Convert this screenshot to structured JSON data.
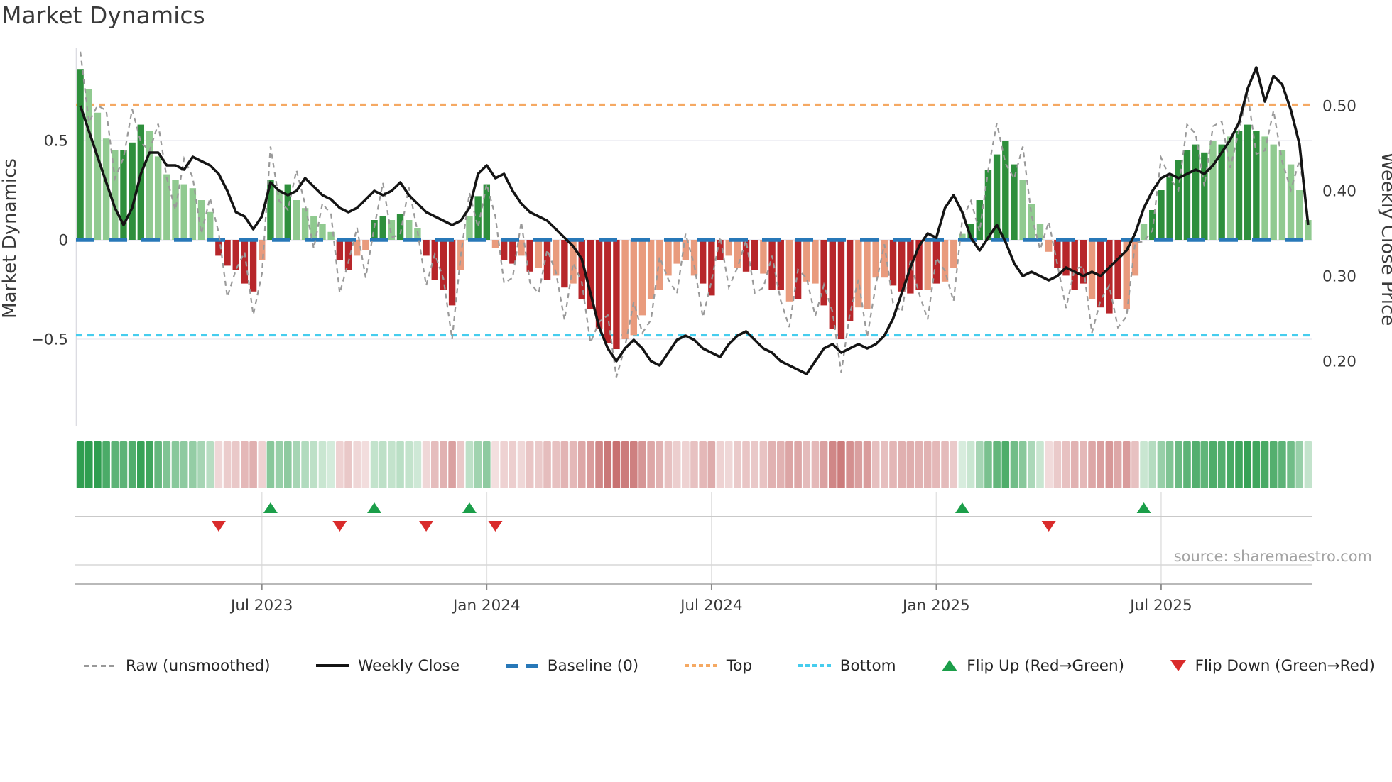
{
  "title": "Market Dynamics",
  "source_note": "source: sharemaestro.com",
  "axes": {
    "left": {
      "title": "Market Dynamics",
      "ticks": [
        {
          "label": "0.5",
          "value": 0.5
        },
        {
          "label": "0",
          "value": 0
        },
        {
          "label": "−0.5",
          "value": -0.5
        }
      ]
    },
    "right": {
      "title": "Weekly Close Price",
      "ticks": [
        {
          "label": "0.50",
          "value": 0.5
        },
        {
          "label": "0.40",
          "value": 0.4
        },
        {
          "label": "0.30",
          "value": 0.3
        },
        {
          "label": "0.20",
          "value": 0.2
        }
      ]
    },
    "x": {
      "ticks": [
        {
          "label": "Jul 2023",
          "week": 21.5
        },
        {
          "label": "Jan 2024",
          "week": 47.5
        },
        {
          "label": "Jul 2024",
          "week": 73.5
        },
        {
          "label": "Jan 2025",
          "week": 99.5
        },
        {
          "label": "Jul 2025",
          "week": 125.5
        }
      ]
    }
  },
  "legend": [
    {
      "id": "raw",
      "label": "Raw (unsmoothed)",
      "marker": "dash-gray"
    },
    {
      "id": "close",
      "label": "Weekly Close",
      "marker": "solid-black"
    },
    {
      "id": "baseline",
      "label": "Baseline (0)",
      "marker": "dash-blue"
    },
    {
      "id": "top",
      "label": "Top",
      "marker": "dot-orange"
    },
    {
      "id": "bottom",
      "label": "Bottom",
      "marker": "dot-cyan"
    },
    {
      "id": "flipup",
      "label": "Flip Up (Red→Green)",
      "marker": "tri-up"
    },
    {
      "id": "flipdown",
      "label": "Flip Down (Green→Red)",
      "marker": "tri-down"
    }
  ],
  "colors": {
    "bar_green_dark": "#2e8f3c",
    "bar_green_light": "#90ca90",
    "bar_red_dark": "#b7262a",
    "bar_red_light": "#e99b7d",
    "close_line": "#141414",
    "raw_line": "#9a9a9a",
    "baseline": "#2878b8",
    "top_line": "#f5a963",
    "bottom_line": "#46cdee",
    "flip_up": "#1b9e49",
    "flip_down": "#d92b2b",
    "heat_green": "#2f9e50",
    "heat_red": "#c36565",
    "grid": "#ebebf2",
    "panel_line": "#c9c9c9",
    "text": "#3a3a3a",
    "muted_text": "#a3a3a3"
  },
  "chart_data": {
    "type": "bar",
    "title": "Market Dynamics",
    "x_unit": "weeks",
    "n_weeks": 143,
    "x_tick_labels": [
      "Jul 2023",
      "Jan 2024",
      "Jul 2024",
      "Jan 2025",
      "Jul 2025"
    ],
    "x_tick_weeks": [
      21.5,
      47.5,
      73.5,
      99.5,
      125.5
    ],
    "left_axis_label": "Market Dynamics",
    "right_axis_label": "Weekly Close Price",
    "left_ylim": [
      -0.93,
      0.97
    ],
    "right_ylim": [
      0.125,
      0.5675
    ],
    "grid": "horizontal only (0.5, 0, -0.5)",
    "legend_position": "bottom row, centered",
    "reference_lines": {
      "baseline": 0,
      "top": 0.68,
      "bottom": -0.48
    },
    "flip_up_weeks": [
      22,
      34,
      45,
      102,
      123
    ],
    "flip_down_weeks": [
      16,
      30,
      40,
      48,
      112
    ],
    "series": [
      {
        "name": "Market Dynamics indicator (smoothed bars)",
        "type": "bar",
        "axis": "left",
        "values": [
          0.86,
          0.76,
          0.64,
          0.51,
          0.45,
          0.45,
          0.49,
          0.58,
          0.55,
          0.42,
          0.33,
          0.3,
          0.28,
          0.26,
          0.2,
          0.14,
          -0.08,
          -0.13,
          -0.15,
          -0.22,
          -0.26,
          -0.1,
          0.3,
          0.25,
          0.28,
          0.2,
          0.16,
          0.12,
          0.08,
          0.04,
          -0.1,
          -0.15,
          -0.08,
          -0.05,
          0.1,
          0.12,
          0.1,
          0.13,
          0.1,
          0.06,
          -0.08,
          -0.2,
          -0.25,
          -0.33,
          -0.15,
          0.12,
          0.22,
          0.28,
          -0.04,
          -0.1,
          -0.12,
          -0.08,
          -0.16,
          -0.14,
          -0.2,
          -0.18,
          -0.24,
          -0.22,
          -0.3,
          -0.35,
          -0.45,
          -0.52,
          -0.55,
          -0.5,
          -0.48,
          -0.38,
          -0.3,
          -0.25,
          -0.18,
          -0.12,
          -0.1,
          -0.18,
          -0.22,
          -0.28,
          -0.1,
          -0.08,
          -0.14,
          -0.16,
          -0.15,
          -0.17,
          -0.25,
          -0.25,
          -0.31,
          -0.3,
          -0.21,
          -0.22,
          -0.33,
          -0.45,
          -0.5,
          -0.41,
          -0.34,
          -0.35,
          -0.19,
          -0.19,
          -0.23,
          -0.26,
          -0.27,
          -0.25,
          -0.25,
          -0.22,
          -0.21,
          -0.14,
          0.03,
          0.08,
          0.2,
          0.35,
          0.43,
          0.5,
          0.38,
          0.3,
          0.18,
          0.08,
          -0.06,
          -0.14,
          -0.18,
          -0.25,
          -0.22,
          -0.3,
          -0.34,
          -0.37,
          -0.3,
          -0.35,
          -0.18,
          0.08,
          0.15,
          0.25,
          0.33,
          0.4,
          0.45,
          0.48,
          0.44,
          0.5,
          0.48,
          0.52,
          0.55,
          0.58,
          0.55,
          0.52,
          0.48,
          0.45,
          0.38,
          0.25,
          0.1
        ],
        "shades": "dlllldddlllllllldddddldldlllllddllddldllddddllddlddldldldldddddllllllllldddlldd_lddldllddddllllddddldlllddddddllllddddldddllldddddddldldddlllllll",
        "shade_note": "d=dark bar, l=light bar; underscore is a literal spacer error guard - ignored by renderer"
      },
      {
        "name": "Weekly Close",
        "type": "line",
        "axis": "right",
        "values": [
          0.5,
          0.47,
          0.44,
          0.41,
          0.38,
          0.36,
          0.38,
          0.42,
          0.445,
          0.445,
          0.43,
          0.43,
          0.425,
          0.44,
          0.435,
          0.43,
          0.42,
          0.4,
          0.375,
          0.37,
          0.355,
          0.37,
          0.41,
          0.4,
          0.395,
          0.4,
          0.415,
          0.405,
          0.395,
          0.39,
          0.38,
          0.375,
          0.38,
          0.39,
          0.4,
          0.395,
          0.4,
          0.41,
          0.395,
          0.385,
          0.375,
          0.37,
          0.365,
          0.36,
          0.365,
          0.38,
          0.42,
          0.43,
          0.415,
          0.42,
          0.4,
          0.385,
          0.375,
          0.37,
          0.365,
          0.355,
          0.345,
          0.335,
          0.32,
          0.28,
          0.24,
          0.215,
          0.2,
          0.215,
          0.225,
          0.215,
          0.2,
          0.195,
          0.21,
          0.225,
          0.23,
          0.225,
          0.215,
          0.21,
          0.205,
          0.22,
          0.23,
          0.235,
          0.225,
          0.215,
          0.21,
          0.2,
          0.195,
          0.19,
          0.185,
          0.2,
          0.215,
          0.22,
          0.21,
          0.215,
          0.22,
          0.215,
          0.22,
          0.23,
          0.25,
          0.28,
          0.31,
          0.335,
          0.35,
          0.345,
          0.38,
          0.395,
          0.375,
          0.345,
          0.33,
          0.345,
          0.36,
          0.34,
          0.315,
          0.3,
          0.305,
          0.3,
          0.295,
          0.3,
          0.31,
          0.305,
          0.3,
          0.305,
          0.3,
          0.31,
          0.32,
          0.33,
          0.35,
          0.38,
          0.4,
          0.415,
          0.42,
          0.415,
          0.42,
          0.425,
          0.42,
          0.43,
          0.445,
          0.46,
          0.48,
          0.52,
          0.545,
          0.505,
          0.535,
          0.525,
          0.495,
          0.455,
          0.36
        ]
      },
      {
        "name": "Raw (unsmoothed)",
        "type": "line",
        "axis": "left",
        "derived_from": "indicator bars",
        "wiggle": {
          "amplitude": 0.17,
          "freq_rad_per_week": 1.95,
          "phase_rad": 2.6
        }
      }
    ],
    "heatmap_strip": "one cell per week; green tint for positive indicator, red tint for negative, intensity proportional to magnitude"
  }
}
